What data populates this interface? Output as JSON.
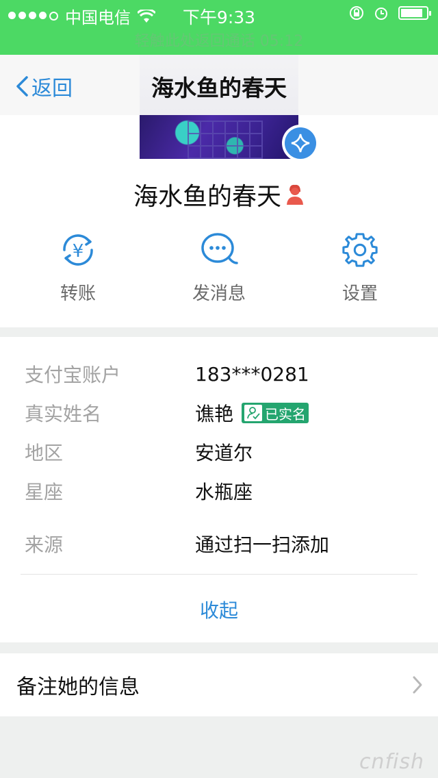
{
  "status_bar": {
    "carrier": "中国电信",
    "time": "下午9:33",
    "call_banner": "轻触此处返回通话 05:12",
    "battery_level": 0.85
  },
  "nav": {
    "back_label": "返回",
    "title": "海水鱼的春天"
  },
  "profile": {
    "name": "海水鱼的春天",
    "actions": [
      {
        "label": "转账",
        "icon": "transfer-yuan-icon"
      },
      {
        "label": "发消息",
        "icon": "chat-bubble-icon"
      },
      {
        "label": "设置",
        "icon": "gear-icon"
      }
    ]
  },
  "info": {
    "rows": [
      {
        "key": "支付宝账户",
        "value": "183***0281"
      },
      {
        "key": "真实姓名",
        "value": "谯艳",
        "badge": "已实名"
      },
      {
        "key": "地区",
        "value": "安道尔"
      },
      {
        "key": "星座",
        "value": "水瓶座"
      },
      {
        "key": "来源",
        "value": "通过扫一扫添加"
      }
    ],
    "collapse_label": "收起"
  },
  "note": {
    "label": "备注她的信息"
  },
  "watermark": "cnfish",
  "colors": {
    "status_green": "#4cd964",
    "accent_blue": "#2c8ad8",
    "verified_green": "#24a56f"
  }
}
